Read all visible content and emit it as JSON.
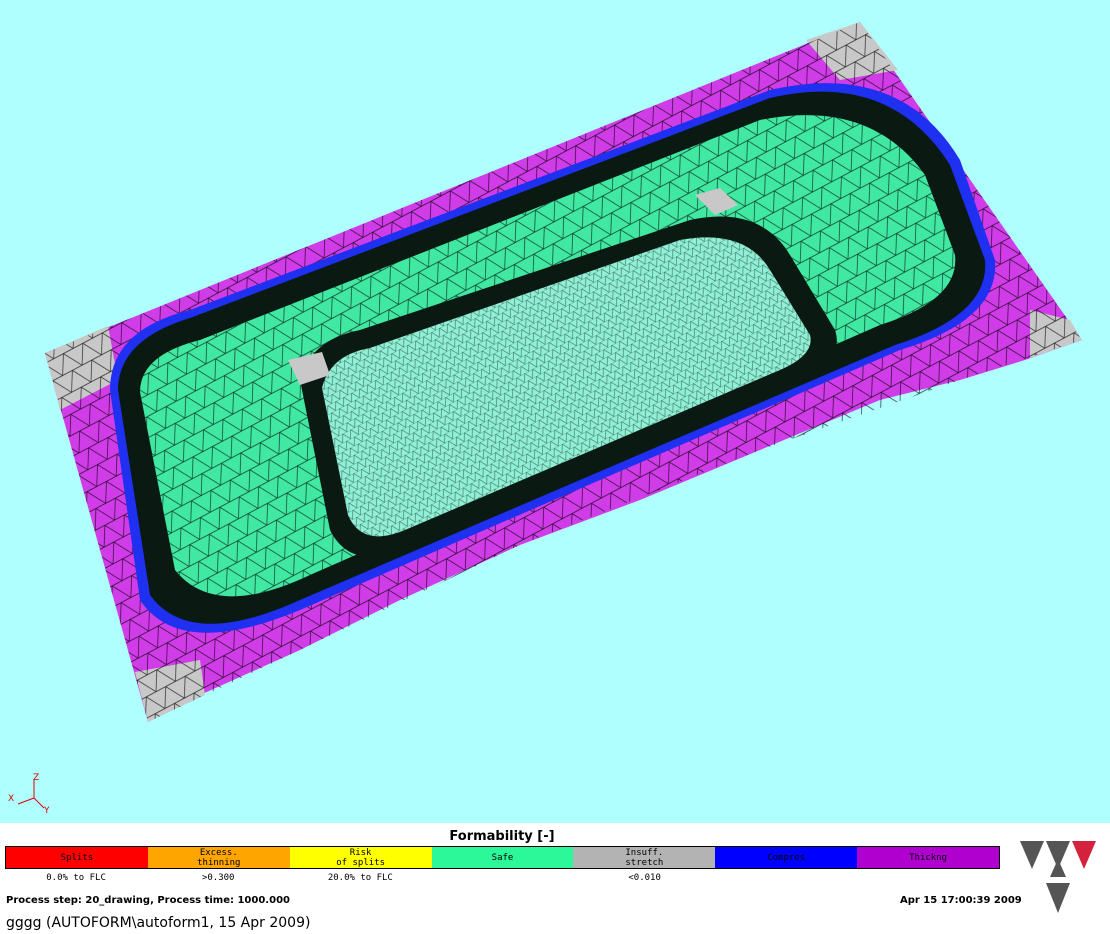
{
  "legend": {
    "title": "Formability [-]",
    "segments": [
      {
        "label": "Splits",
        "color": "#ff0000",
        "range": "0.0% to FLC"
      },
      {
        "label": "Excess.\nthinning",
        "color": "#ffa500",
        "range": ">0.300"
      },
      {
        "label": "Risk\nof splits",
        "color": "#ffff00",
        "range": "20.0% to FLC"
      },
      {
        "label": "Safe",
        "color": "#2cf89a",
        "range": ""
      },
      {
        "label": "Insuff.\nstretch",
        "color": "#b3b3b3",
        "range": "<0.010"
      },
      {
        "label": "Compres",
        "color": "#0000ff",
        "range": ""
      },
      {
        "label": "Thickng",
        "color": "#b000d0",
        "range": ""
      }
    ]
  },
  "status": {
    "process": "Process step: 20_drawing, Process time: 1000.000",
    "date": "Apr 15 17:00:39 2009",
    "title": "gggg (AUTOFORM\\autoform1, 15 Apr 2009)"
  },
  "axes": {
    "x": "X",
    "y": "Y",
    "z": "Z"
  },
  "colors": {
    "background": "#afffff",
    "safe": "#2cf89a",
    "thickening": "#d03ce8",
    "compression": "#2030f0",
    "insufficient_stretch": "#c8c8c8",
    "mesh": "#000000"
  }
}
